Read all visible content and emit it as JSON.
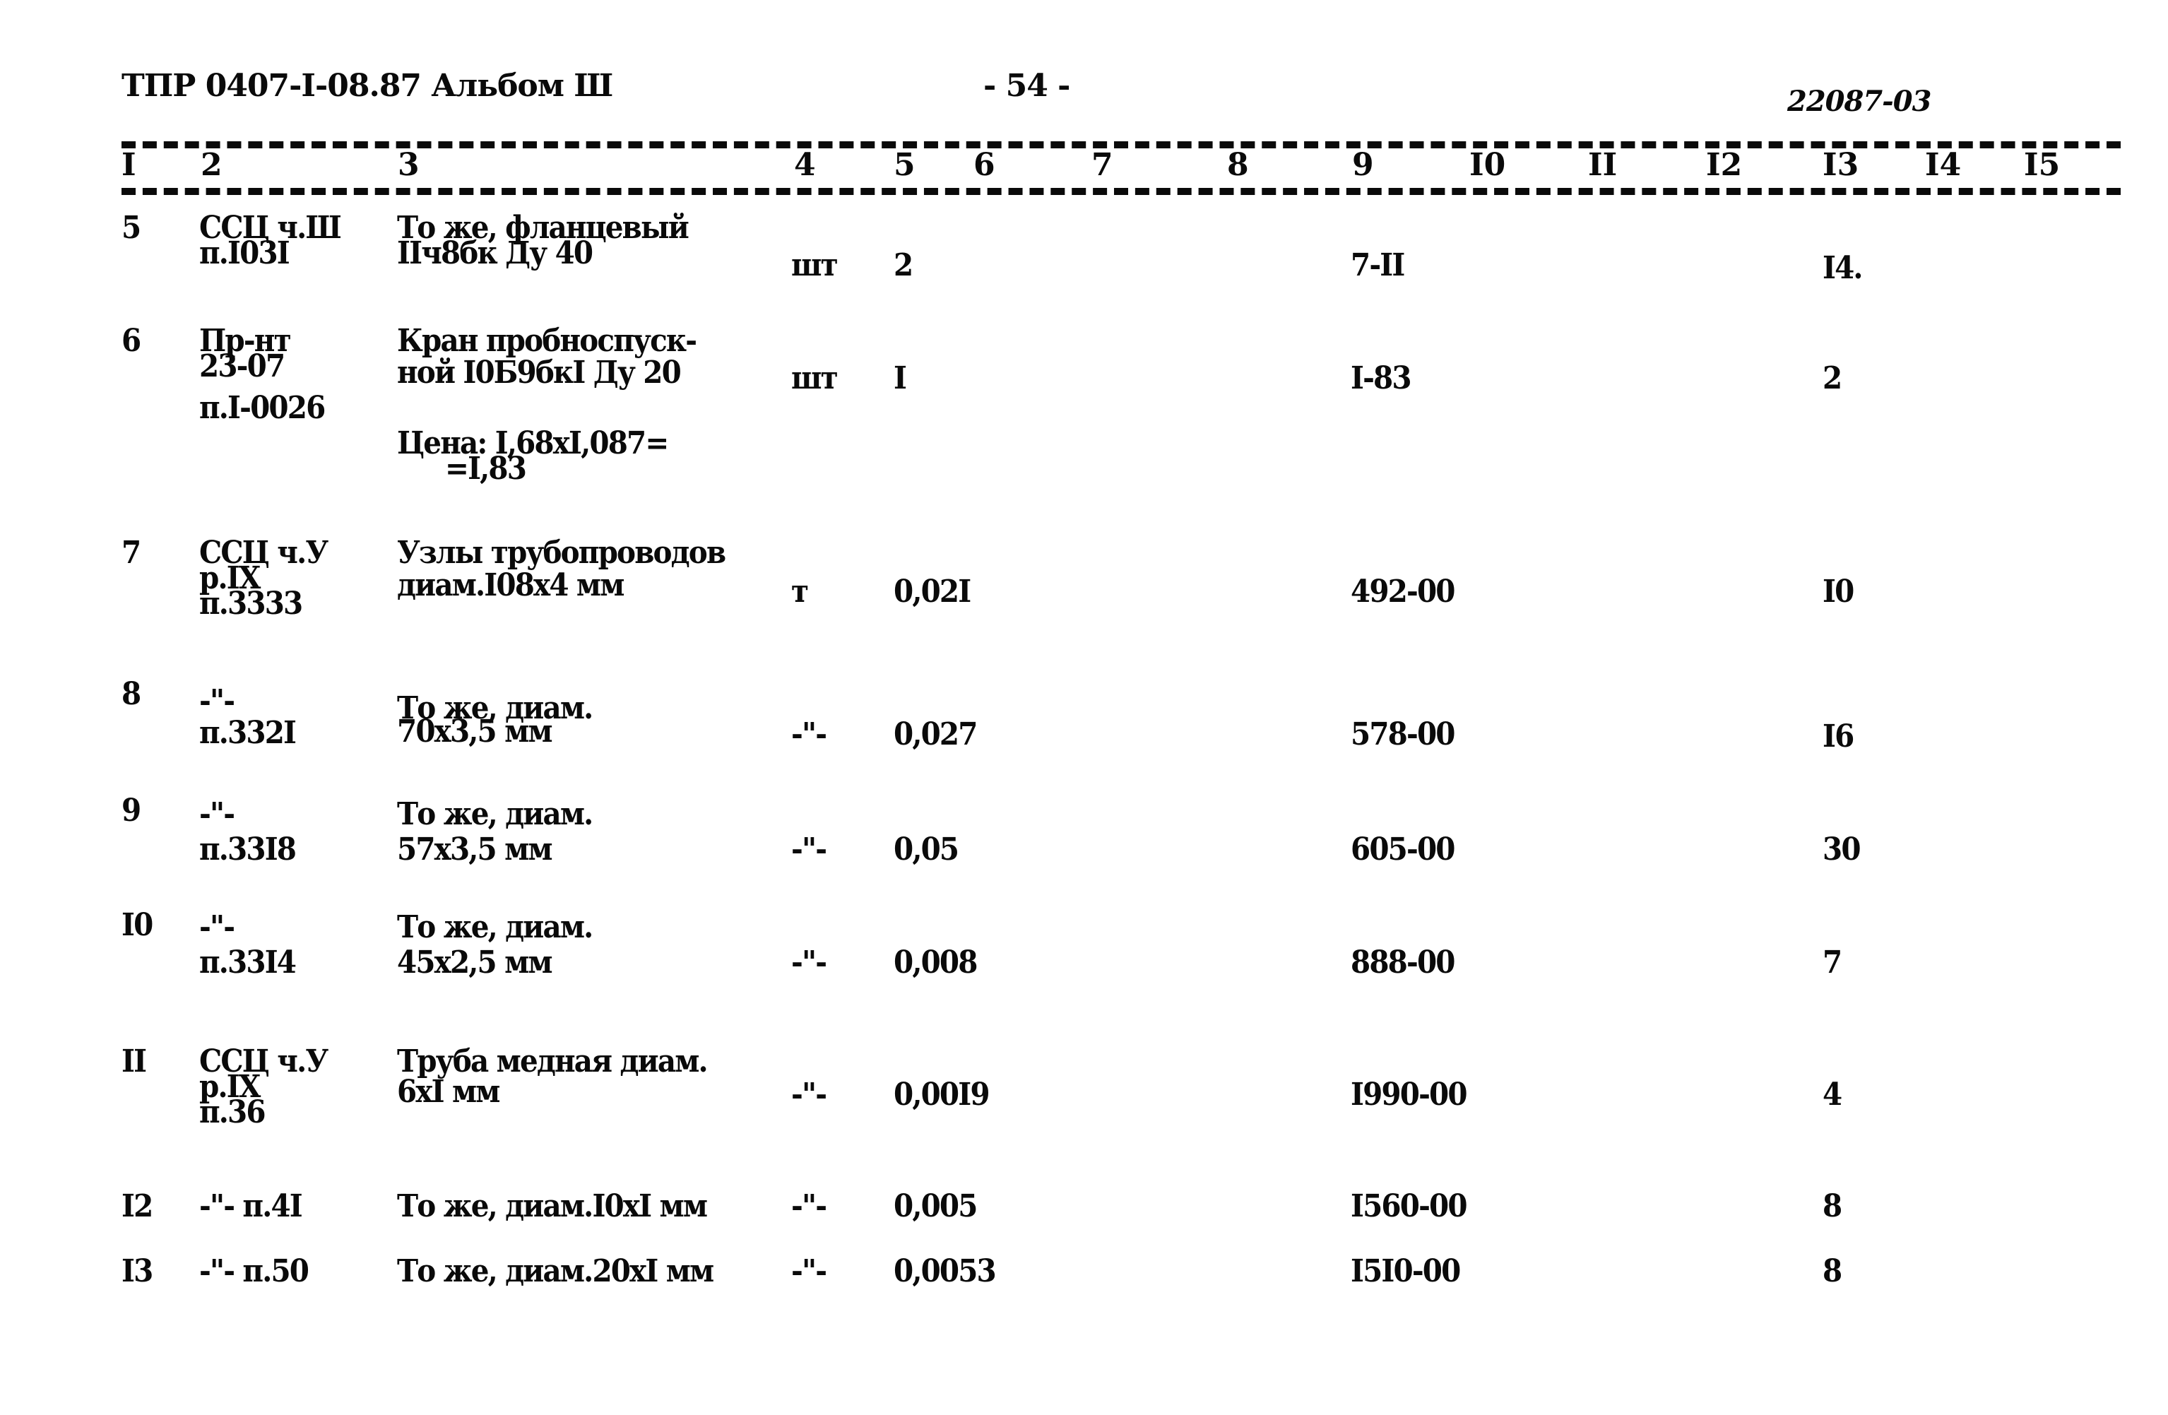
{
  "header": {
    "doc_id": "ТПР 0407-I-08.87 Альбом Ш",
    "page_number": "- 54 -",
    "code": "22087-03"
  },
  "column_numbers": [
    "I",
    "2",
    "3",
    "4",
    "5",
    "6",
    "7",
    "8",
    "9",
    "I0",
    "II",
    "I2",
    "I3",
    "I4",
    "I5"
  ],
  "rows": [
    {
      "num": "5",
      "ref": [
        "ССЦ ч.Ш",
        "п.I03I"
      ],
      "desc": [
        "То же, фланцевый",
        "IIч8бк Ду 40"
      ],
      "unit": "шт",
      "qty": "2",
      "price": "7-II",
      "col13": "I4."
    },
    {
      "num": "6",
      "ref": [
        "Пр-нт",
        "23-07",
        "п.I-0026"
      ],
      "desc": [
        "Кран пробноспуск-",
        "ной I0Б9бкI Ду 20"
      ],
      "note": [
        "Цена: I,68хI,087=",
        "=I,83"
      ],
      "unit": "шт",
      "qty": "I",
      "price": "I-83",
      "col13": "2"
    },
    {
      "num": "7",
      "ref": [
        "ССЦ ч.У",
        "р.IX",
        "п.3333"
      ],
      "desc": [
        "Узлы трубопроводов",
        "диам.I08х4 мм"
      ],
      "unit": "т",
      "qty": "0,02I",
      "price": "492-00",
      "col13": "I0"
    },
    {
      "num": "8",
      "ref": [
        "-\"-",
        "п.332I"
      ],
      "desc": [
        "То же, диам.",
        "70х3,5 мм"
      ],
      "unit": "-\"-",
      "qty": "0,027",
      "price": "578-00",
      "col13": "I6"
    },
    {
      "num": "9",
      "ref": [
        "-\"-",
        "п.33I8"
      ],
      "desc": [
        "То же, диам.",
        "57х3,5 мм"
      ],
      "unit": "-\"-",
      "qty": "0,05",
      "price": "605-00",
      "col13": "30"
    },
    {
      "num": "I0",
      "ref": [
        "-\"-",
        "п.33I4"
      ],
      "desc": [
        "То же, диам.",
        "45х2,5 мм"
      ],
      "unit": "-\"-",
      "qty": "0,008",
      "price": "888-00",
      "col13": "7"
    },
    {
      "num": "II",
      "ref": [
        "ССЦ ч.У",
        "р.IX",
        "п.36"
      ],
      "desc": [
        "Труба медная диам.",
        "6хI мм"
      ],
      "unit": "-\"-",
      "qty": "0,00I9",
      "price": "I990-00",
      "col13": "4"
    },
    {
      "num": "I2",
      "ref": [
        "-\"- п.4I"
      ],
      "desc": [
        "То же, диам.I0хI мм"
      ],
      "unit": "-\"-",
      "qty": "0,005",
      "price": "I560-00",
      "col13": "8"
    },
    {
      "num": "I3",
      "ref": [
        "-\"- п.50"
      ],
      "desc": [
        "То же, диам.20хI мм"
      ],
      "unit": "-\"-",
      "qty": "0,0053",
      "price": "I5I0-00",
      "col13": "8"
    }
  ]
}
